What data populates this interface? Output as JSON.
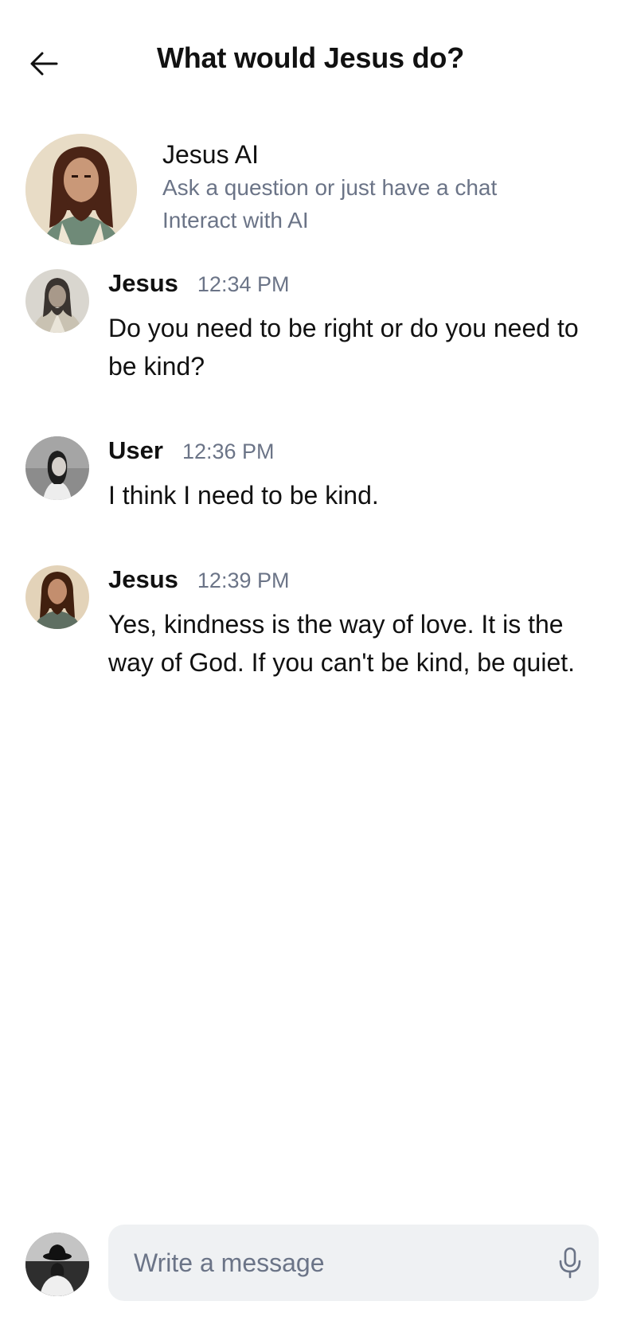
{
  "header": {
    "title": "What would Jesus do?",
    "back_icon": "arrow-left-icon"
  },
  "bot": {
    "name": "Jesus AI",
    "subtitle_line1": "Ask a question or just have a chat",
    "subtitle_line2": "Interact with AI",
    "avatar_icon": "jesus-portrait-avatar"
  },
  "messages": [
    {
      "author": "Jesus",
      "time": "12:34 PM",
      "text": "Do you need to be right or do you need to be kind?",
      "avatar": "jesus-robed-avatar"
    },
    {
      "author": "User",
      "time": "12:36 PM",
      "text": "I think I need to be kind.",
      "avatar": "woman-photo-avatar"
    },
    {
      "author": "Jesus",
      "time": "12:39 PM",
      "text": "Yes, kindness is the way of love. It is the way of God. If you can't be kind, be quiet.",
      "avatar": "jesus-portrait-avatar"
    }
  ],
  "composer": {
    "placeholder": "Write a message",
    "value": "",
    "mic_icon": "microphone-icon",
    "user_avatar": "user-hat-photo-avatar"
  },
  "colors": {
    "text": "#111111",
    "muted": "#6b7487",
    "input_bg": "#eff1f3",
    "background": "#ffffff"
  }
}
